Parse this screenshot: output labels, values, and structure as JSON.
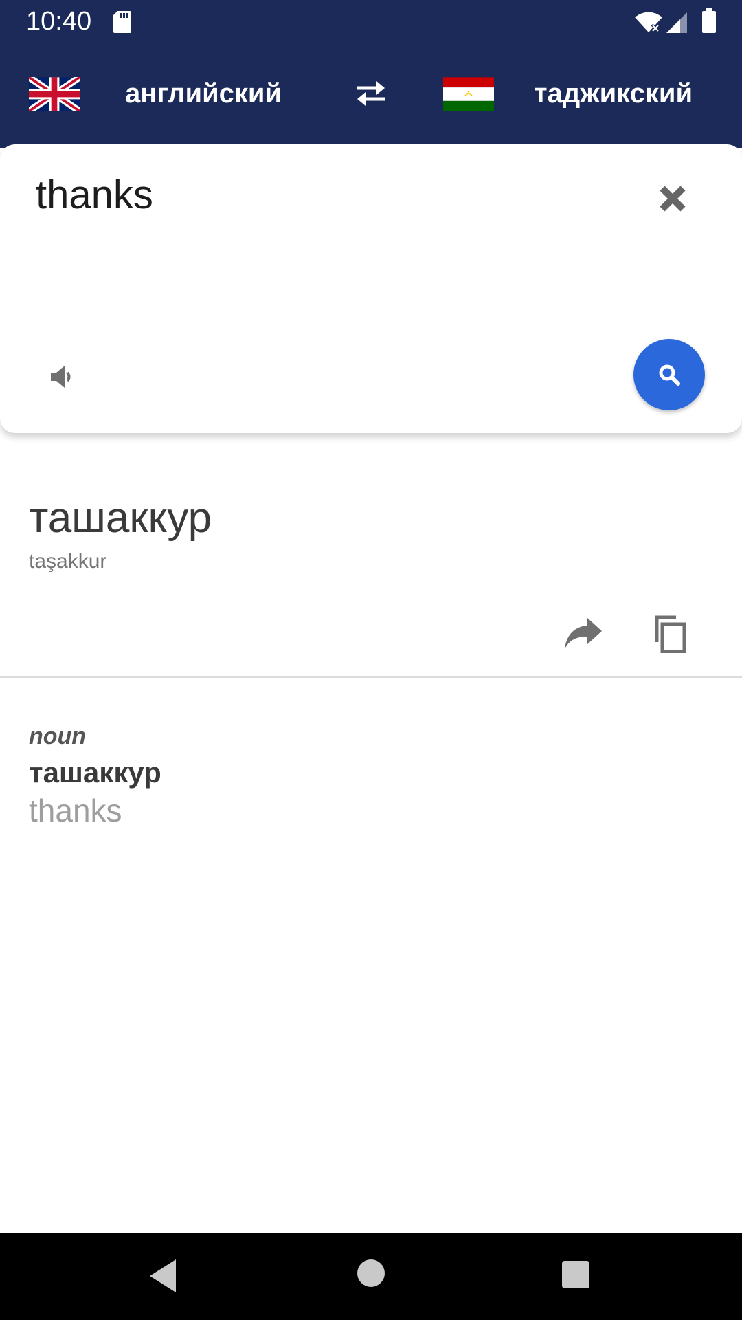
{
  "status_bar": {
    "time": "10:40",
    "icons": [
      "sd-card-icon",
      "wifi-icon",
      "signal-icon",
      "battery-icon"
    ]
  },
  "language_bar": {
    "source_language": "английский",
    "target_language": "таджикский",
    "source_flag": "uk-flag-icon",
    "target_flag": "tajikistan-flag-icon",
    "swap_icon": "swap-icon"
  },
  "input": {
    "text": "thanks",
    "clear_icon": "close-icon",
    "speak_icon": "speaker-icon",
    "search_icon": "search-icon"
  },
  "result": {
    "translation": "ташаккур",
    "transliteration": "taşakkur",
    "actions": [
      "share-icon",
      "copy-icon"
    ]
  },
  "dictionary": {
    "part_of_speech": "noun",
    "word": "ташаккур",
    "meaning": "thanks"
  },
  "colors": {
    "header": "#1b2a58",
    "accent": "#2b68dc"
  }
}
